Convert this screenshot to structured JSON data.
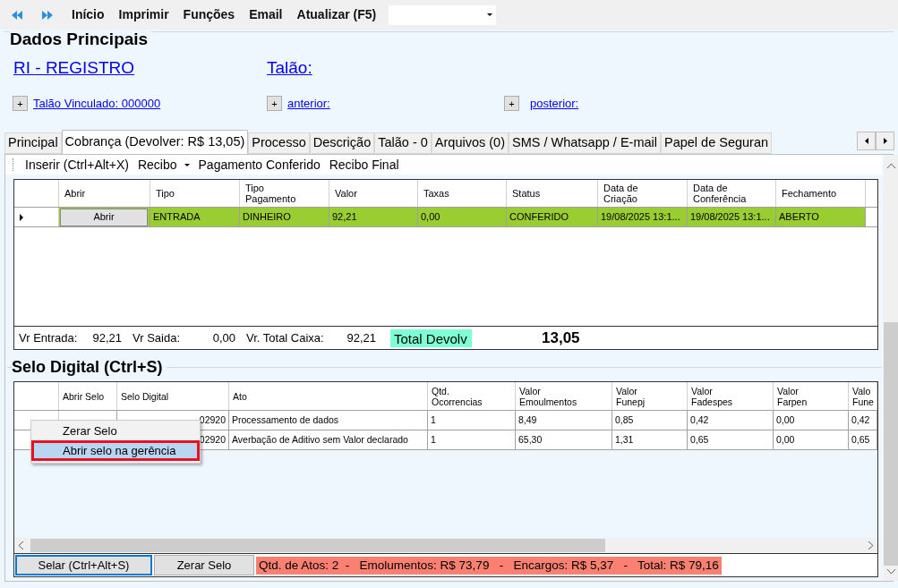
{
  "toolbar": {
    "menu": [
      "Início",
      "Imprimir",
      "Funções",
      "Email",
      "Atualizar (F5)"
    ]
  },
  "dados": {
    "title": "Dados Principais",
    "primary_link": "RI - REGISTRO",
    "talao_link": "Talão:",
    "expanders": [
      {
        "symbol": "+",
        "label": "Talão Vinculado: 000000"
      },
      {
        "symbol": "+",
        "label": "anterior:"
      },
      {
        "symbol": "+",
        "label": "posterior:"
      }
    ]
  },
  "tabs": [
    {
      "label": "Principal",
      "selected": false
    },
    {
      "label": "Cobrança (Devolver: R$ 13,05)",
      "selected": true
    },
    {
      "label": "Processo",
      "selected": false
    },
    {
      "label": "Descrição",
      "selected": false
    },
    {
      "label": "Talão - 0",
      "selected": false
    },
    {
      "label": "Arquivos (0)",
      "selected": false
    },
    {
      "label": "SMS / Whatsapp / E-mail",
      "selected": false
    },
    {
      "label": "Papel de Seguran",
      "selected": false
    }
  ],
  "cobranca": {
    "actions": [
      {
        "label": "Inserir (Ctrl+Alt+X)",
        "kind": "plain"
      },
      {
        "label": "Recibo",
        "kind": "dropdown"
      },
      {
        "label": "Pagamento Conferido",
        "kind": "plain"
      },
      {
        "label": "Recibo Final",
        "kind": "plain"
      }
    ],
    "columns": [
      "Abrir",
      "Tipo",
      "Tipo\nPagamento",
      "Valor",
      "Taxas",
      "Status",
      "Data de\nCriação",
      "Data de\nConferência",
      "Fechamento"
    ],
    "rows": [
      {
        "current": true,
        "color": "#9acd32",
        "cells": [
          "Abrir",
          "ENTRADA",
          "DINHEIRO",
          "92,21",
          "0,00",
          "CONFERIDO",
          "19/08/2025 13:1...",
          "19/08/2025 13:1...",
          "ABERTO"
        ]
      }
    ],
    "summary": [
      {
        "label": "Vr Entrada:",
        "value": "92,21"
      },
      {
        "label": "Vr Saida:",
        "value": "0,00"
      },
      {
        "label": "Vr. Total Caixa:",
        "value": "92,21"
      }
    ],
    "total": {
      "label": "Total Devolv",
      "value": "13,05"
    }
  },
  "selo": {
    "title": "Selo Digital (Ctrl+S)",
    "columns": [
      "Abrir Selo",
      "Selo Digital",
      "Ato",
      "Qtd.\nOcorrencias",
      "Valor\nEmoulmentos",
      "Valor\nFunepj",
      "Valor\nFadespes",
      "Valor\nFarpen",
      "Valo\nFune"
    ],
    "rows": [
      {
        "cells": [
          "",
          "02920",
          "Processamento de dados",
          "1",
          "8,49",
          "0,85",
          "0,42",
          "0,00",
          "0,42"
        ]
      },
      {
        "cells": [
          "",
          "02920",
          "Averbação de Aditivo sem Valor declarado",
          "1",
          "65,30",
          "1,31",
          "0,65",
          "0,00",
          "0,65"
        ]
      }
    ],
    "context_menu": [
      {
        "label": "Zerar Selo",
        "selected": false
      },
      {
        "label": "Abrir selo na gerência",
        "selected": true
      }
    ],
    "buttons": [
      {
        "label": "Selar (Ctrl+Alt+S)",
        "selected": true
      },
      {
        "label": "Zerar Selo",
        "selected": false
      }
    ],
    "totals": "Qtd. de Atos: 2  -   Emolumentos: R$ 73,79   -   Encargos: R$ 5,37   -   Total: R$ 79,16"
  }
}
